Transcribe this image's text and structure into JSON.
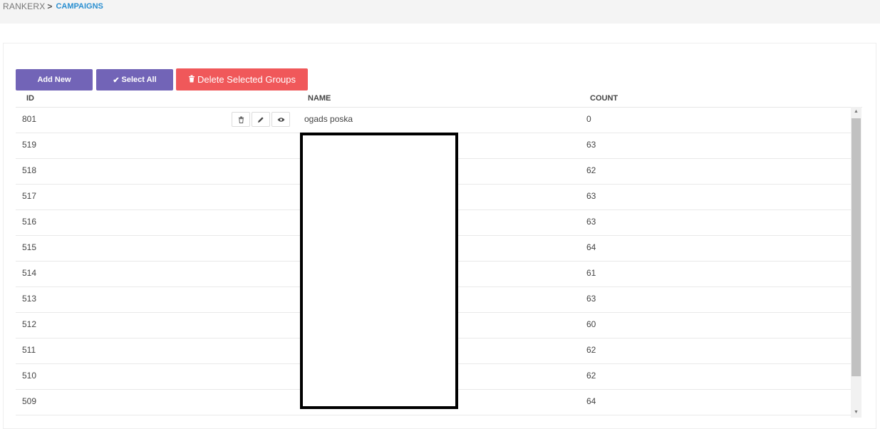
{
  "breadcrumb": {
    "root": "RANKERX",
    "separator": ">",
    "current": "CAMPAIGNS"
  },
  "toolbar": {
    "add_new": "Add New",
    "select_all": "Select All",
    "select_all_icon": "check-icon",
    "delete_selected": "Delete Selected Groups",
    "delete_icon": "trash-icon"
  },
  "table": {
    "columns": [
      "ID",
      "NAME",
      "COUNT"
    ],
    "rows": [
      {
        "id": "801",
        "name": "ogads poska",
        "count": "0"
      },
      {
        "id": "519",
        "name": "",
        "count": "63"
      },
      {
        "id": "518",
        "name": "",
        "count": "62"
      },
      {
        "id": "517",
        "name": "",
        "count": "63"
      },
      {
        "id": "516",
        "name": "",
        "count": "63"
      },
      {
        "id": "515",
        "name": "",
        "count": "64"
      },
      {
        "id": "514",
        "name": "",
        "count": "61"
      },
      {
        "id": "513",
        "name": "",
        "count": "63"
      },
      {
        "id": "512",
        "name": "",
        "count": "60"
      },
      {
        "id": "511",
        "name": "",
        "count": "62"
      },
      {
        "id": "510",
        "name": "",
        "count": "62"
      },
      {
        "id": "509",
        "name": "",
        "count": "64"
      }
    ],
    "row_actions": [
      "trash-icon",
      "pencil-icon",
      "eye-icon"
    ]
  },
  "colors": {
    "primary_button": "#7264b7",
    "danger_button": "#f0585a",
    "breadcrumb_link": "#2a8fd1"
  }
}
